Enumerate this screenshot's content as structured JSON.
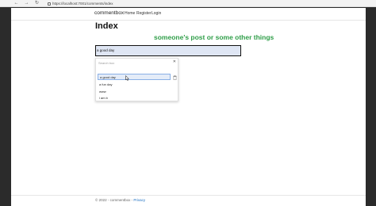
{
  "browser": {
    "back_icon": "arrow-left-icon",
    "forward_icon": "arrow-right-icon",
    "refresh_icon": "refresh-icon",
    "address": "https://localhost:7001/comments/index"
  },
  "navbar": {
    "brand": "commentbox",
    "links": [
      "Home",
      "Register",
      "Login"
    ]
  },
  "main": {
    "title": "Index",
    "headline": "someone's post or some other things",
    "headline_color": "#2f9e48",
    "comment_value": "a good day"
  },
  "dropdown": {
    "search_placeholder": "Search box",
    "close_icon": "close-icon",
    "items": [
      "a good day",
      "a fun day",
      "www",
      "i am b"
    ],
    "active_index": 0,
    "trash_icon": "trash-icon"
  },
  "footer": {
    "copyright": "© 2022 - commentbox -",
    "privacy": "Privacy"
  }
}
